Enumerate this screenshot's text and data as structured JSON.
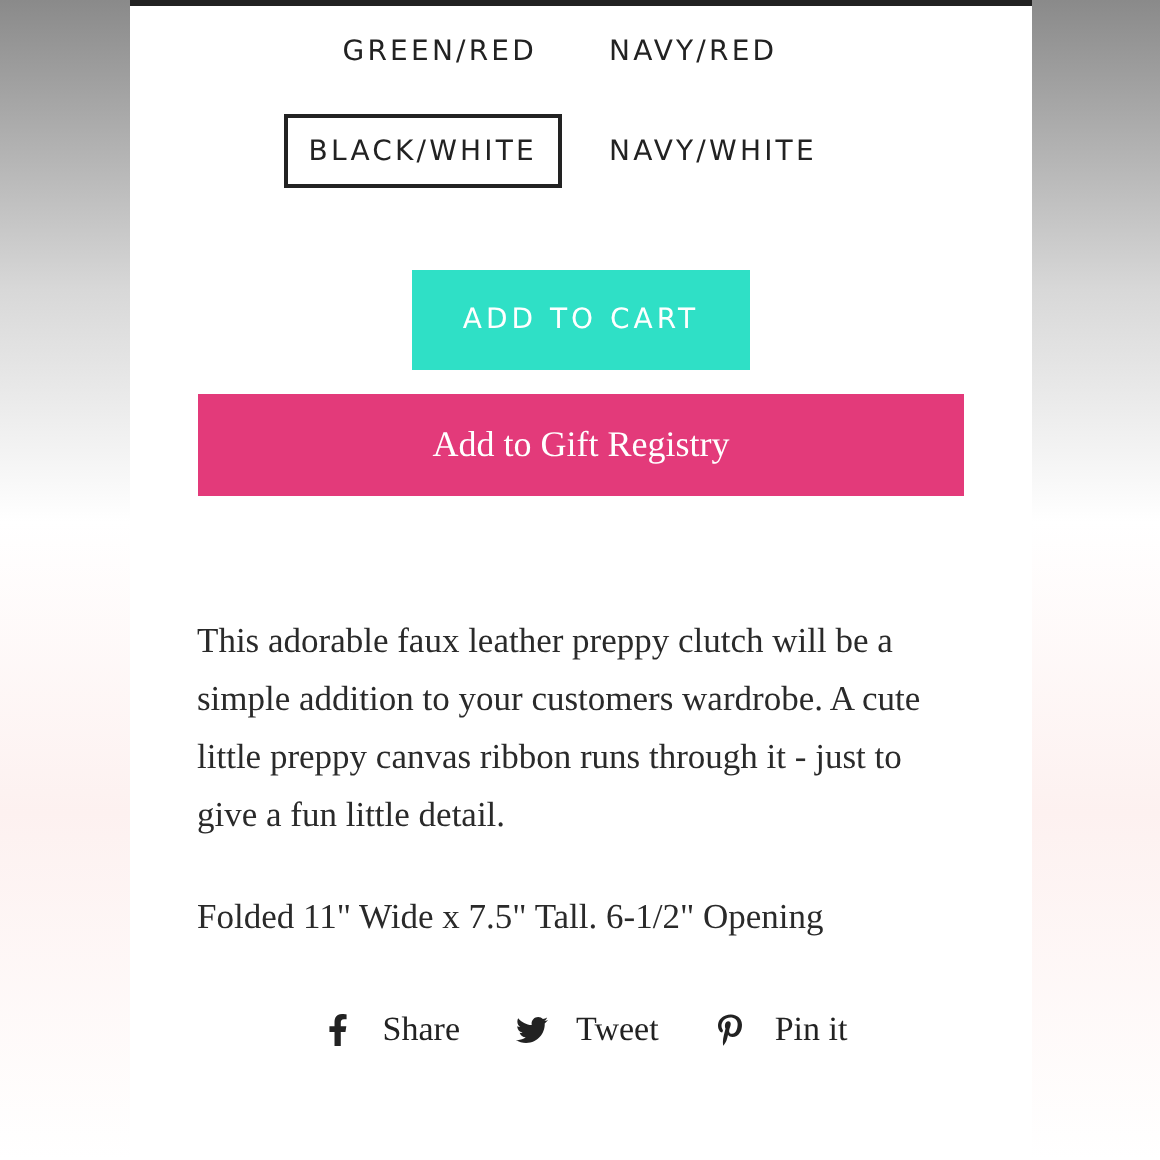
{
  "variants": [
    {
      "label": "GREEN/RED",
      "selected": false
    },
    {
      "label": "NAVY/RED",
      "selected": false
    },
    {
      "label": "BLACK/WHITE",
      "selected": true
    },
    {
      "label": "NAVY/WHITE",
      "selected": false
    }
  ],
  "add_to_cart": "ADD TO CART",
  "gift_registry": "Add to Gift Registry",
  "description": [
    "This adorable faux leather preppy clutch will be a simple addition to your customers wardrobe. A cute little preppy canvas ribbon runs through it - just to give a fun little detail.",
    "Folded 11\" Wide x 7.5\" Tall. 6-1/2\" Opening"
  ],
  "share_links": [
    {
      "kind": "facebook",
      "label": "Share"
    },
    {
      "kind": "twitter",
      "label": "Tweet"
    },
    {
      "kind": "pinterest",
      "label": "Pin it"
    }
  ]
}
